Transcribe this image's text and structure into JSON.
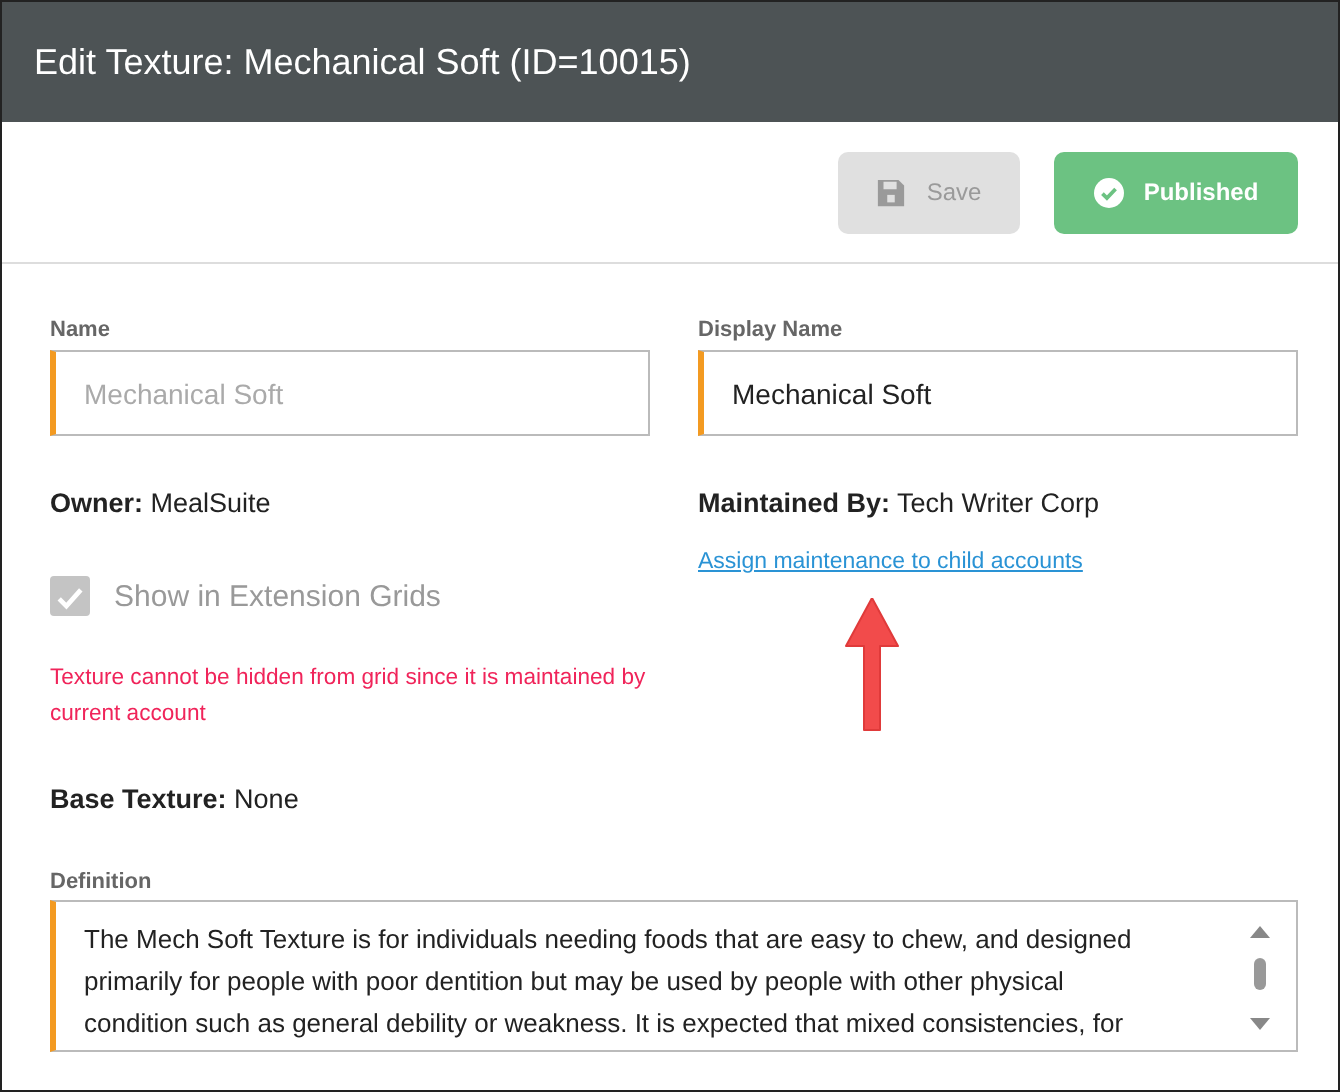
{
  "window": {
    "title": "Edit Texture: Mechanical Soft (ID=10015)"
  },
  "toolbar": {
    "buttons": [
      {
        "kind": "save",
        "label": "Save",
        "disabled": true
      },
      {
        "kind": "publish",
        "label": "Published",
        "disabled": false
      }
    ]
  },
  "fields": [
    {
      "label": "Name",
      "placeholder": "Mechanical Soft"
    },
    {
      "label": "Display Name",
      "value": "Mechanical Soft"
    }
  ],
  "owner": {
    "label": "Owner:",
    "value": "MealSuite"
  },
  "maintained_by": {
    "label": "Maintained By:",
    "value": "Tech Writer Corp"
  },
  "link": "Assign maintenance to child accounts",
  "checkbox": {
    "label": "Show in Extension Grids",
    "checked": true,
    "disabled": true
  },
  "warning": "Texture cannot be hidden from grid since it is maintained by current account",
  "base_texture": {
    "label": "Base Texture:",
    "value": "None"
  },
  "definition": {
    "label": "Definition",
    "lines": [
      "The Mech Soft Texture is for individuals needing foods that are easy to chew, and designed",
      "primarily for people with poor dentition but may be used by people with other physical",
      "condition such as general debility or weakness. It is expected that mixed consistencies, for"
    ]
  }
}
